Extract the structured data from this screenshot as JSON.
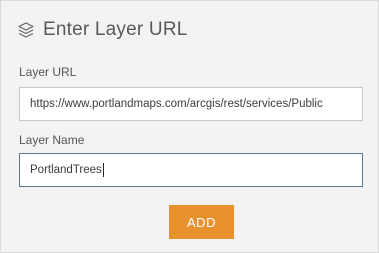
{
  "header": {
    "title": "Enter Layer URL",
    "icon": "layers-icon"
  },
  "layer_url": {
    "label": "Layer URL",
    "value": "https://www.portlandmaps.com/arcgis/rest/services/Public"
  },
  "layer_name": {
    "label": "Layer Name",
    "value": "PortlandTrees"
  },
  "actions": {
    "add_label": "ADD"
  },
  "colors": {
    "accent": "#e8922f",
    "background": "#f3f3f3",
    "active_border": "#5e7b96"
  }
}
